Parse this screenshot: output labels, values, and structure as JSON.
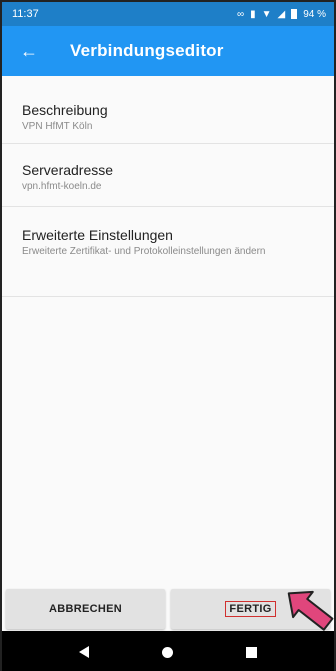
{
  "status": {
    "time": "11:37",
    "battery": "94 %",
    "icons": [
      "link-icon",
      "vibrate-icon",
      "wifi-icon",
      "signal-icon",
      "battery-icon"
    ]
  },
  "toolbar": {
    "title": "Verbindungseditor",
    "back_icon": "arrow-left-icon"
  },
  "items": [
    {
      "label": "Beschreibung",
      "value": "VPN HfMT Köln"
    },
    {
      "label": "Serveradresse",
      "value": "vpn.hfmt-koeln.de"
    },
    {
      "label": "Erweiterte Einstellungen",
      "value": "Erweiterte Zertifikat- und Protokolleinstellungen ändern"
    }
  ],
  "buttons": {
    "cancel": "ABBRECHEN",
    "done": "FERTIG"
  },
  "colors": {
    "statusbar": "#1e7fc8",
    "toolbar": "#2196f3",
    "highlight": "#d0302f",
    "annotation_arrow": "#e0467c"
  }
}
